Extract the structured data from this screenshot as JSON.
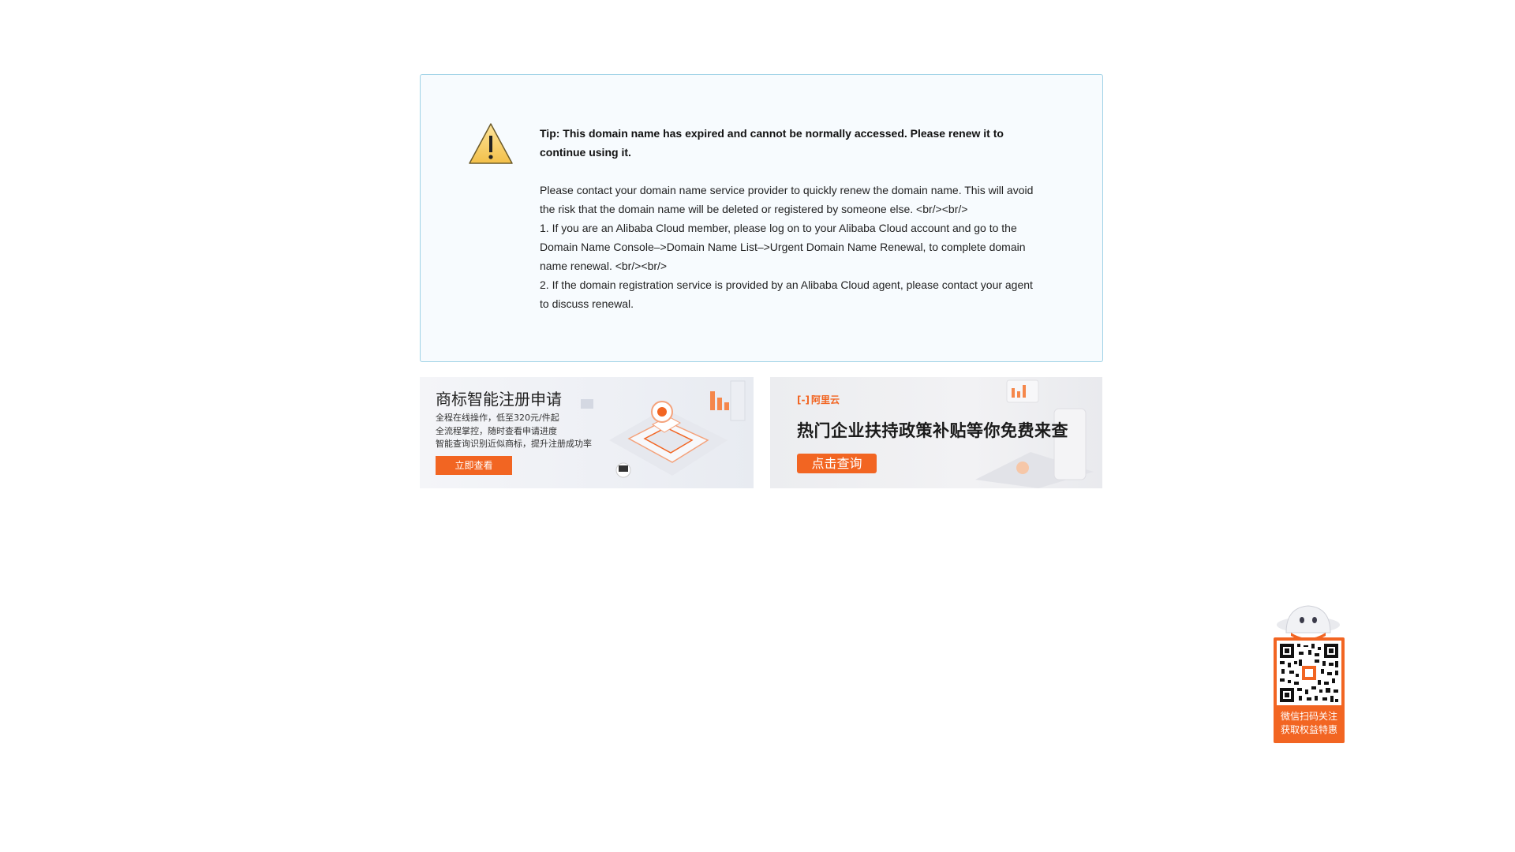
{
  "notice": {
    "title": "Tip: This domain name has expired and cannot be normally accessed. Please renew it to continue using it.",
    "body_lines": [
      "Please contact your domain name service provider to quickly renew the domain name. This will avoid the risk that the domain name will be deleted or registered by someone else. <br/><br/>",
      "1. If you are an Alibaba Cloud member, please log on to your Alibaba Cloud account and go to the Domain Name Console–>Domain Name List–>Urgent Domain Name Renewal, to complete domain name renewal. <br/><br/>",
      "2. If the domain registration service is provided by an Alibaba Cloud agent, please contact your agent to discuss renewal."
    ],
    "icon": "warning-triangle-icon",
    "colors": {
      "border": "#9fd2e6",
      "background": "#f7fbfe"
    }
  },
  "banner_left": {
    "title": "商标智能注册申请",
    "lines": [
      "全程在线操作，低至320元/件起",
      "全流程掌控，随时查看申请进度",
      "智能查询识别近似商标，提升注册成功率"
    ],
    "button": "立即查看"
  },
  "banner_right": {
    "logo_text": "阿里云",
    "title": "热门企业扶持政策补贴等你免费来查",
    "button": "点击查询"
  },
  "qr_widget": {
    "caption_line1": "微信扫码关注",
    "caption_line2": "获取权益特惠"
  },
  "colors": {
    "accent": "#f26522"
  }
}
